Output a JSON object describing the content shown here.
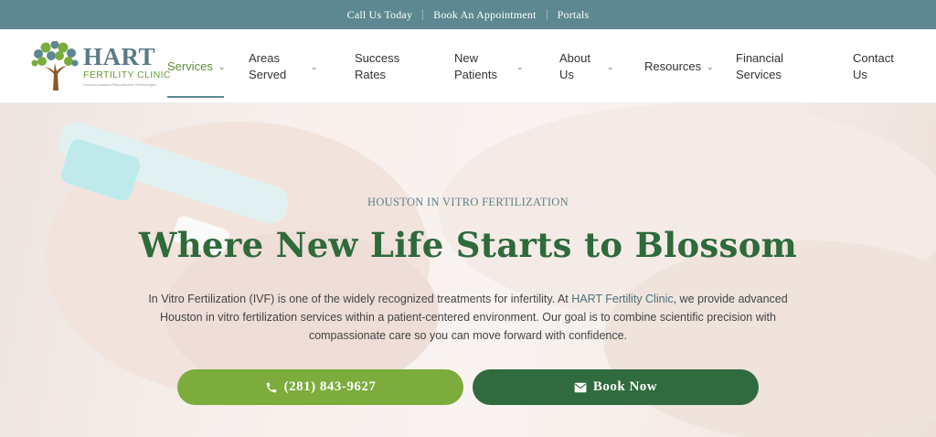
{
  "topbar": {
    "links": [
      "Call Us Today",
      "Book An Appointment",
      "Portals"
    ]
  },
  "logo": {
    "title": "HART",
    "subtitle": "FERTILITY CLINIC",
    "tagline": "Houston Assisted Reproductive Technologies"
  },
  "nav": {
    "items": [
      {
        "label": "Services",
        "has_dropdown": true,
        "active": true
      },
      {
        "label": "Areas Served",
        "has_dropdown": true
      },
      {
        "label": "Success Rates",
        "has_dropdown": false
      },
      {
        "label": "New Patients",
        "has_dropdown": true
      },
      {
        "label": "About Us",
        "has_dropdown": true
      },
      {
        "label": "Resources",
        "has_dropdown": true
      },
      {
        "label": "Financial Services",
        "has_dropdown": false
      },
      {
        "label": "Contact Us",
        "has_dropdown": false
      }
    ]
  },
  "hero": {
    "eyebrow": "HOUSTON IN VITRO FERTILIZATION",
    "headline": "Where New Life Starts to Blossom",
    "para_start": "In Vitro Fertilization (IVF) is one of the widely recognized treatments for infertility. At ",
    "para_link": "HART Fertility Clinic",
    "para_end": ", we provide advanced Houston in vitro fertilization services within a patient-centered environment. Our goal is to combine scientific precision with compassionate care so you can move forward with confidence.",
    "call_button": "(281) 843-9627",
    "book_button": "Book Now"
  },
  "colors": {
    "topbar": "#5d8891",
    "accent_green": "#7bac3c",
    "dark_green": "#2f6b3e",
    "headline": "#2e6a3a"
  }
}
